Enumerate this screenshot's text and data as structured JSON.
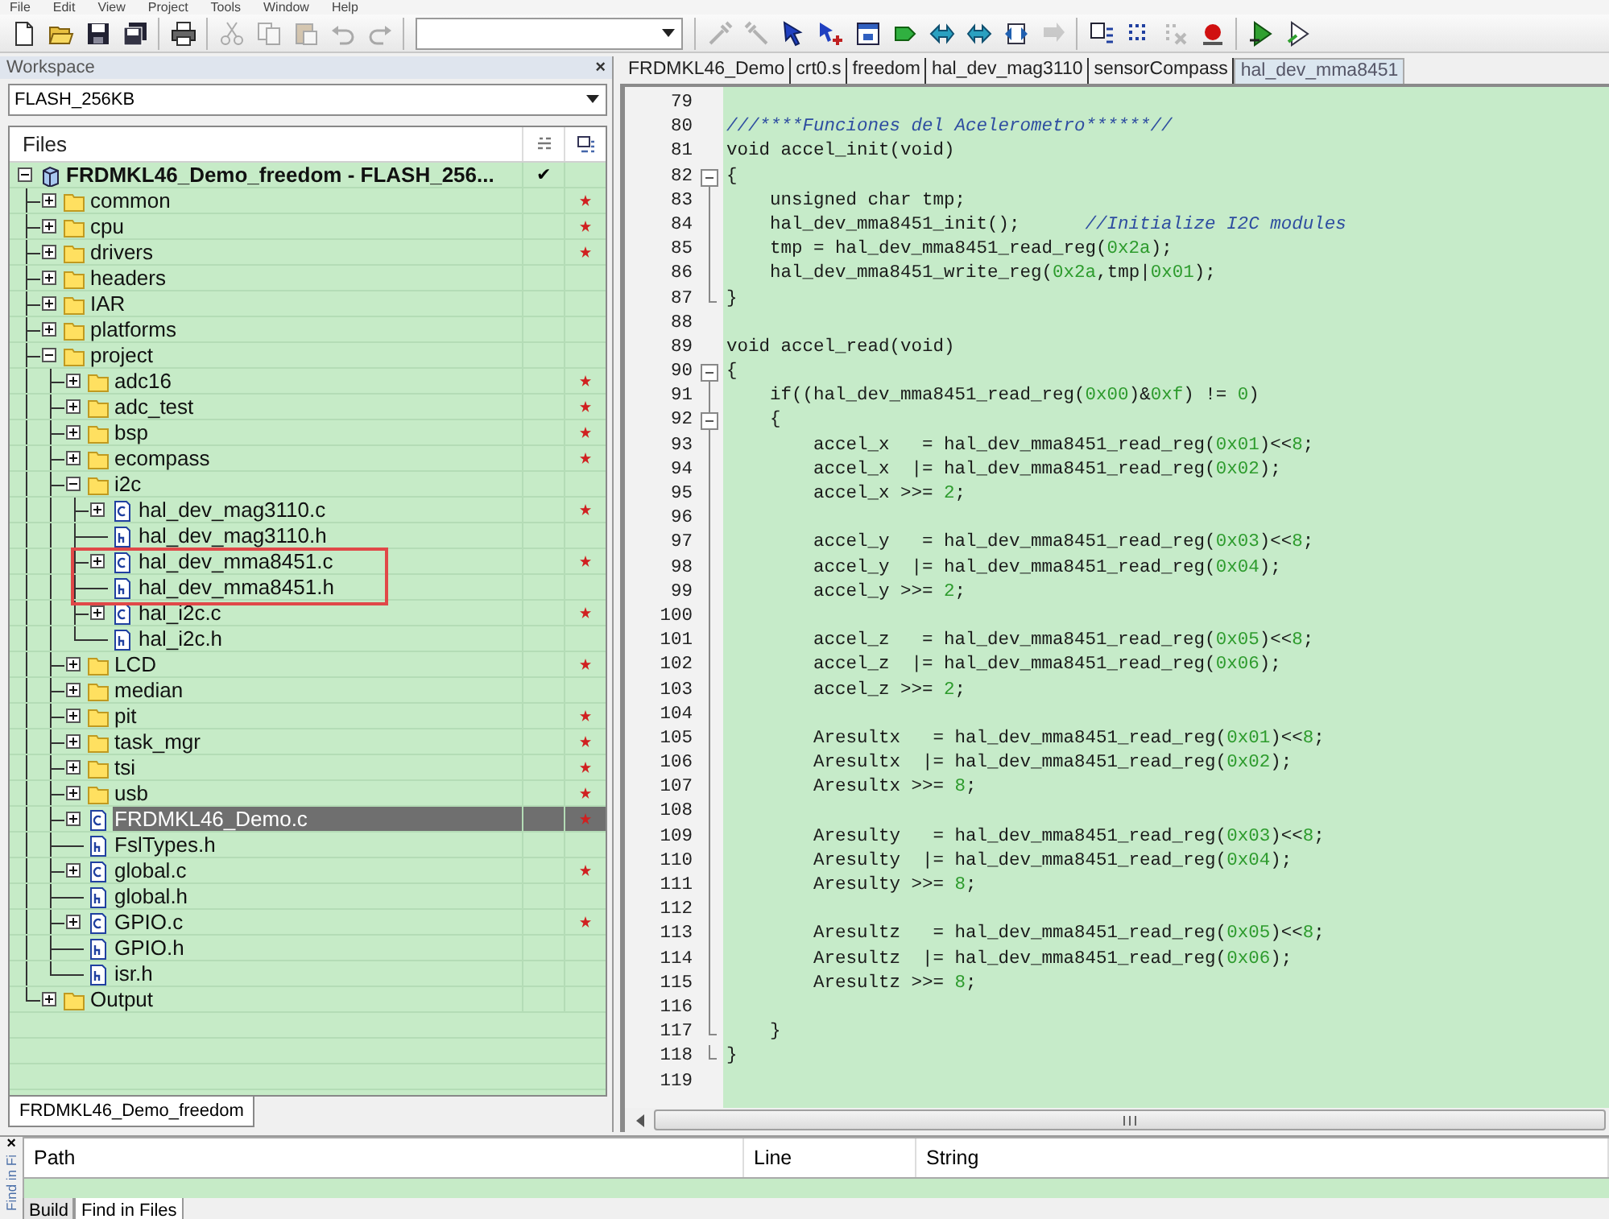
{
  "menu": [
    "File",
    "Edit",
    "View",
    "Project",
    "Tools",
    "Window",
    "Help"
  ],
  "toolbar": [
    {
      "disabled": false
    },
    {
      "disabled": false
    },
    {
      "disabled": false
    },
    {
      "disabled": false
    },
    {
      "disabled": false
    },
    {
      "disabled": true
    },
    {
      "disabled": true
    },
    {
      "disabled": true
    },
    {
      "disabled": true
    },
    {
      "disabled": true
    },
    {
      "disabled": true
    },
    {
      "disabled": true
    },
    {
      "disabled": false
    },
    {
      "disabled": false
    },
    {
      "disabled": false
    },
    {
      "disabled": false
    },
    {
      "disabled": false
    },
    {
      "disabled": false
    },
    {
      "disabled": false
    },
    {
      "disabled": true
    },
    {
      "disabled": false
    },
    {
      "disabled": false
    },
    {
      "disabled": true
    },
    {
      "disabled": false
    },
    {
      "disabled": false
    },
    {
      "disabled": false
    }
  ],
  "workspace": {
    "title": "Workspace",
    "close": "×",
    "configuration": "FLASH_256KB",
    "files_header": "Files",
    "tree": [
      {
        "name": "FRDMKL46_Demo_freedom - FLASH_256...",
        "kind": "project",
        "expanded": true,
        "check": "✔",
        "modified": false,
        "selected": false,
        "children": [
          {
            "name": "common",
            "kind": "folder",
            "expanded": false,
            "modified": true,
            "selected": false
          },
          {
            "name": "cpu",
            "kind": "folder",
            "expanded": false,
            "modified": true,
            "selected": false
          },
          {
            "name": "drivers",
            "kind": "folder",
            "expanded": false,
            "modified": true,
            "selected": false
          },
          {
            "name": "headers",
            "kind": "folder",
            "expanded": false,
            "modified": false,
            "selected": false
          },
          {
            "name": "IAR",
            "kind": "folder",
            "expanded": false,
            "modified": false,
            "selected": false
          },
          {
            "name": "platforms",
            "kind": "folder",
            "expanded": false,
            "modified": false,
            "selected": false
          },
          {
            "name": "project",
            "kind": "folder",
            "expanded": true,
            "modified": false,
            "selected": false,
            "children": [
              {
                "name": "adc16",
                "kind": "folder",
                "expanded": false,
                "modified": true,
                "selected": false
              },
              {
                "name": "adc_test",
                "kind": "folder",
                "expanded": false,
                "modified": true,
                "selected": false
              },
              {
                "name": "bsp",
                "kind": "folder",
                "expanded": false,
                "modified": true,
                "selected": false
              },
              {
                "name": "ecompass",
                "kind": "folder",
                "expanded": false,
                "modified": true,
                "selected": false
              },
              {
                "name": "i2c",
                "kind": "folder",
                "expanded": true,
                "modified": false,
                "selected": false,
                "children": [
                  {
                    "name": "hal_dev_mag3110.c",
                    "kind": "c",
                    "expanded": false,
                    "modified": true,
                    "selected": false,
                    "highlighted": false
                  },
                  {
                    "name": "hal_dev_mag3110.h",
                    "kind": "h",
                    "modified": false,
                    "selected": false,
                    "highlighted": false
                  },
                  {
                    "name": "hal_dev_mma8451.c",
                    "kind": "c",
                    "expanded": false,
                    "modified": true,
                    "selected": false,
                    "highlighted": true
                  },
                  {
                    "name": "hal_dev_mma8451.h",
                    "kind": "h",
                    "modified": false,
                    "selected": false,
                    "highlighted": true
                  },
                  {
                    "name": "hal_i2c.c",
                    "kind": "c",
                    "expanded": false,
                    "modified": true,
                    "selected": false,
                    "highlighted": false
                  },
                  {
                    "name": "hal_i2c.h",
                    "kind": "h",
                    "modified": false,
                    "selected": false,
                    "highlighted": false
                  }
                ]
              },
              {
                "name": "LCD",
                "kind": "folder",
                "expanded": false,
                "modified": true,
                "selected": false
              },
              {
                "name": "median",
                "kind": "folder",
                "expanded": false,
                "modified": false,
                "selected": false
              },
              {
                "name": "pit",
                "kind": "folder",
                "expanded": false,
                "modified": true,
                "selected": false
              },
              {
                "name": "task_mgr",
                "kind": "folder",
                "expanded": false,
                "modified": true,
                "selected": false
              },
              {
                "name": "tsi",
                "kind": "folder",
                "expanded": false,
                "modified": true,
                "selected": false
              },
              {
                "name": "usb",
                "kind": "folder",
                "expanded": false,
                "modified": true,
                "selected": false
              },
              {
                "name": "FRDMKL46_Demo.c",
                "kind": "c",
                "expanded": false,
                "modified": true,
                "selected": true
              },
              {
                "name": "FslTypes.h",
                "kind": "h",
                "modified": false,
                "selected": false
              },
              {
                "name": "global.c",
                "kind": "c",
                "expanded": false,
                "modified": true,
                "selected": false
              },
              {
                "name": "global.h",
                "kind": "h",
                "modified": false,
                "selected": false
              },
              {
                "name": "GPIO.c",
                "kind": "c",
                "expanded": false,
                "modified": true,
                "selected": false
              },
              {
                "name": "GPIO.h",
                "kind": "h",
                "modified": false,
                "selected": false
              },
              {
                "name": "isr.h",
                "kind": "h",
                "modified": false,
                "selected": false
              }
            ]
          },
          {
            "name": "Output",
            "kind": "folder",
            "expanded": false,
            "modified": false,
            "selected": false
          }
        ]
      }
    ],
    "bottom_tab": "FRDMKL46_Demo_freedom"
  },
  "editor": {
    "tabs": [
      {
        "label": "FRDMKL46_Demo",
        "selected": false
      },
      {
        "label": "crt0.s",
        "selected": false
      },
      {
        "label": "freedom",
        "selected": false
      },
      {
        "label": "hal_dev_mag3110",
        "selected": false
      },
      {
        "label": "sensorCompass",
        "selected": false
      },
      {
        "label": "hal_dev_mma8451",
        "selected": true
      }
    ],
    "lines": [
      {
        "number": "79"
      },
      {
        "number": "80",
        "text": "///****Funciones del Acelerometro******//"
      },
      {
        "number": "81",
        "text": "void accel_init(void)"
      },
      {
        "number": "82",
        "text": "{",
        "kind": "block-start"
      },
      {
        "number": "83",
        "text": "    unsigned char tmp;"
      },
      {
        "number": "84",
        "text": "    hal_dev_mma8451_init();      //Initialize I2C modules"
      },
      {
        "number": "85",
        "text": "    tmp = hal_dev_mma8451_read_reg(0x2a);"
      },
      {
        "number": "86",
        "text": "    hal_dev_mma8451_write_reg(0x2a,tmp|0x01);"
      },
      {
        "number": "87",
        "text": "}",
        "kind": "block-end"
      },
      {
        "number": "88"
      },
      {
        "number": "89",
        "text": "void accel_read(void)"
      },
      {
        "number": "90",
        "text": "{",
        "kind": "block-start"
      },
      {
        "number": "91",
        "text": "    if((hal_dev_mma8451_read_reg(0x00)&0xf) != 0)"
      },
      {
        "number": "92",
        "text": "    {",
        "kind": "block-start"
      },
      {
        "number": "93",
        "text": "        accel_x   = hal_dev_mma8451_read_reg(0x01)<<8;"
      },
      {
        "number": "94",
        "text": "        accel_x  |= hal_dev_mma8451_read_reg(0x02);"
      },
      {
        "number": "95",
        "text": "        accel_x >>= 2;"
      },
      {
        "number": "96"
      },
      {
        "number": "97",
        "text": "        accel_y   = hal_dev_mma8451_read_reg(0x03)<<8;"
      },
      {
        "number": "98",
        "text": "        accel_y  |= hal_dev_mma8451_read_reg(0x04);"
      },
      {
        "number": "99",
        "text": "        accel_y >>= 2;"
      },
      {
        "number": "100"
      },
      {
        "number": "101",
        "text": "        accel_z   = hal_dev_mma8451_read_reg(0x05)<<8;"
      },
      {
        "number": "102",
        "text": "        accel_z  |= hal_dev_mma8451_read_reg(0x06);"
      },
      {
        "number": "103",
        "text": "        accel_z >>= 2;"
      },
      {
        "number": "104"
      },
      {
        "number": "105",
        "text": "        Aresultx   = hal_dev_mma8451_read_reg(0x01)<<8;"
      },
      {
        "number": "106",
        "text": "        Aresultx  |= hal_dev_mma8451_read_reg(0x02);"
      },
      {
        "number": "107",
        "text": "        Aresultx >>= 8;"
      },
      {
        "number": "108"
      },
      {
        "number": "109",
        "text": "        Aresulty   = hal_dev_mma8451_read_reg(0x03)<<8;"
      },
      {
        "number": "110",
        "text": "        Aresulty  |= hal_dev_mma8451_read_reg(0x04);"
      },
      {
        "number": "111",
        "text": "        Aresulty >>= 8;"
      },
      {
        "number": "112"
      },
      {
        "number": "113",
        "text": "        Aresultz   = hal_dev_mma8451_read_reg(0x05)<<8;"
      },
      {
        "number": "114",
        "text": "        Aresultz  |= hal_dev_mma8451_read_reg(0x06);"
      },
      {
        "number": "115",
        "text": "        Aresultz >>= 8;"
      },
      {
        "number": "116"
      },
      {
        "number": "117",
        "text": "    }",
        "kind": "block-end"
      },
      {
        "number": "118",
        "text": "}",
        "kind": "block-end"
      },
      {
        "number": "119"
      }
    ]
  },
  "output": {
    "close": "×",
    "title": "Find in Fi",
    "columns": [
      "Path",
      "Line",
      "String"
    ],
    "tabs": [
      {
        "label": "Build",
        "selected": false
      },
      {
        "label": "Find in Files",
        "selected": true
      }
    ]
  }
}
